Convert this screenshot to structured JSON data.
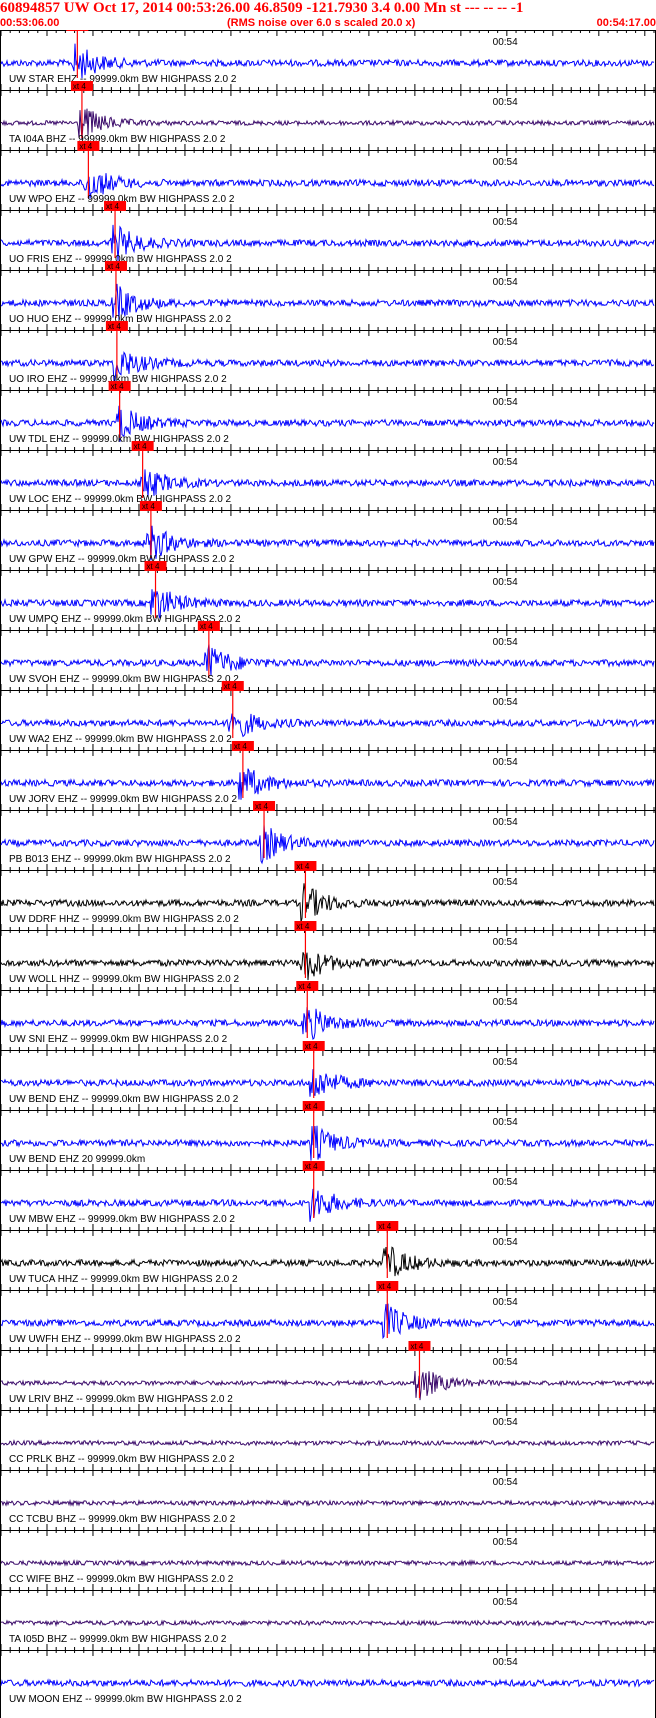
{
  "header": {
    "title": "60894857 UW Oct 17, 2014 00:53:26.00   46.8509 -121.7930  3.4 0.00 Mn st --- -- --  -1",
    "start_time": "00:53:06.00",
    "note": "(RMS noise over 6.0 s scaled 20.0 x)",
    "end_time": "00:54:17.00",
    "title_color": "#ff0000"
  },
  "colors": {
    "trace_blue": "#0000ff",
    "trace_black": "#000000",
    "trace_purple": "#3a0a6a",
    "pick": "#ff0000",
    "axis": "#000000"
  },
  "chart_data": {
    "type": "line",
    "title": "60894857 UW Oct 17, 2014 00:53:26.00   46.8509 -121.7930  3.4 0.00 Mn st --- -- --  -1",
    "x_range": [
      "00:53:06.00",
      "00:54:17.00"
    ],
    "x_tick_label": "00:54",
    "pick_label": "xt 4",
    "grid": false,
    "series": [
      {
        "name": "UW STAR EHZ -- 99999.0km BW  HIGHPASS  2.0  2",
        "color": "blue",
        "pick_time": 8.3
      },
      {
        "name": "TA I04A BHZ -- 99999.0km BW  HIGHPASS  2.0  2",
        "color": "purple",
        "pick_time": 8.8
      },
      {
        "name": "UW WPO EHZ -- 99999.0km BW  HIGHPASS  2.0  2",
        "color": "blue",
        "pick_time": 9.5
      },
      {
        "name": "UO FRIS EHZ -- 99999.0km BW  HIGHPASS  2.0  2",
        "color": "blue",
        "pick_time": 12.4
      },
      {
        "name": "UO HUO EHZ -- 99999.0km BW  HIGHPASS  2.0  2",
        "color": "blue",
        "pick_time": 12.5
      },
      {
        "name": "UO IRO EHZ -- 99999.0km BW  HIGHPASS  2.0  2",
        "color": "blue",
        "pick_time": 12.6
      },
      {
        "name": "UW TDL EHZ -- 99999.0km BW  HIGHPASS  2.0  2",
        "color": "blue",
        "pick_time": 12.9
      },
      {
        "name": "UW LOC EHZ -- 99999.0km BW  HIGHPASS  2.0  2",
        "color": "blue",
        "pick_time": 15.4
      },
      {
        "name": "UW GPW EHZ -- 99999.0km BW  HIGHPASS  2.0  2",
        "color": "blue",
        "pick_time": 16.3
      },
      {
        "name": "UW UMPQ EHZ -- 99999.0km BW  HIGHPASS  2.0  2",
        "color": "blue",
        "pick_time": 16.8
      },
      {
        "name": "UW SVOH EHZ -- 99999.0km BW  HIGHPASS  2.0  2",
        "color": "blue",
        "pick_time": 22.6
      },
      {
        "name": "UW WA2 EHZ -- 99999.0km BW  HIGHPASS  2.0  2",
        "color": "blue",
        "pick_time": 25.2
      },
      {
        "name": "UW JORV EHZ -- 99999.0km BW  HIGHPASS  2.0  2",
        "color": "blue",
        "pick_time": 26.3
      },
      {
        "name": "PB B013 EHZ -- 99999.0km BW  HIGHPASS  2.0  2",
        "color": "blue",
        "pick_time": 28.6
      },
      {
        "name": "UW DDRF HHZ -- 99999.0km BW  HIGHPASS  2.0  2",
        "color": "black",
        "pick_time": 33.1
      },
      {
        "name": "UW WOLL HHZ -- 99999.0km BW  HIGHPASS  2.0  2",
        "color": "black",
        "pick_time": 33.1
      },
      {
        "name": "UW SNI EHZ -- 99999.0km BW  HIGHPASS  2.0  2",
        "color": "blue",
        "pick_time": 33.3
      },
      {
        "name": "UW BEND EHZ -- 99999.0km BW  HIGHPASS  2.0  2",
        "color": "blue",
        "pick_time": 34.0
      },
      {
        "name": "UW BEND EHZ 20 99999.0km",
        "color": "blue",
        "pick_time": 34.0
      },
      {
        "name": "UW MBW EHZ -- 99999.0km BW  HIGHPASS  2.0  2",
        "color": "blue",
        "pick_time": 34.0
      },
      {
        "name": "UW TUCA HHZ -- 99999.0km BW  HIGHPASS  2.0  2",
        "color": "black",
        "pick_time": 42.0
      },
      {
        "name": "UW UWFH EHZ -- 99999.0km BW  HIGHPASS  2.0  2",
        "color": "blue",
        "pick_time": 42.0
      },
      {
        "name": "UW LRIV BHZ -- 99999.0km BW  HIGHPASS  2.0  2",
        "color": "purple",
        "pick_time": 45.5
      },
      {
        "name": "CC PRLK BHZ -- 99999.0km BW  HIGHPASS  2.0  2",
        "color": "purple"
      },
      {
        "name": "CC TCBU BHZ -- 99999.0km BW  HIGHPASS  2.0  2",
        "color": "purple"
      },
      {
        "name": "CC WIFE BHZ -- 99999.0km BW  HIGHPASS  2.0  2",
        "color": "purple"
      },
      {
        "name": "TA I05D BHZ -- 99999.0km BW  HIGHPASS  2.0  2",
        "color": "purple"
      },
      {
        "name": "UW MOON EHZ -- 99999.0km BW  HIGHPASS  2.0  2",
        "color": "blue"
      }
    ]
  }
}
